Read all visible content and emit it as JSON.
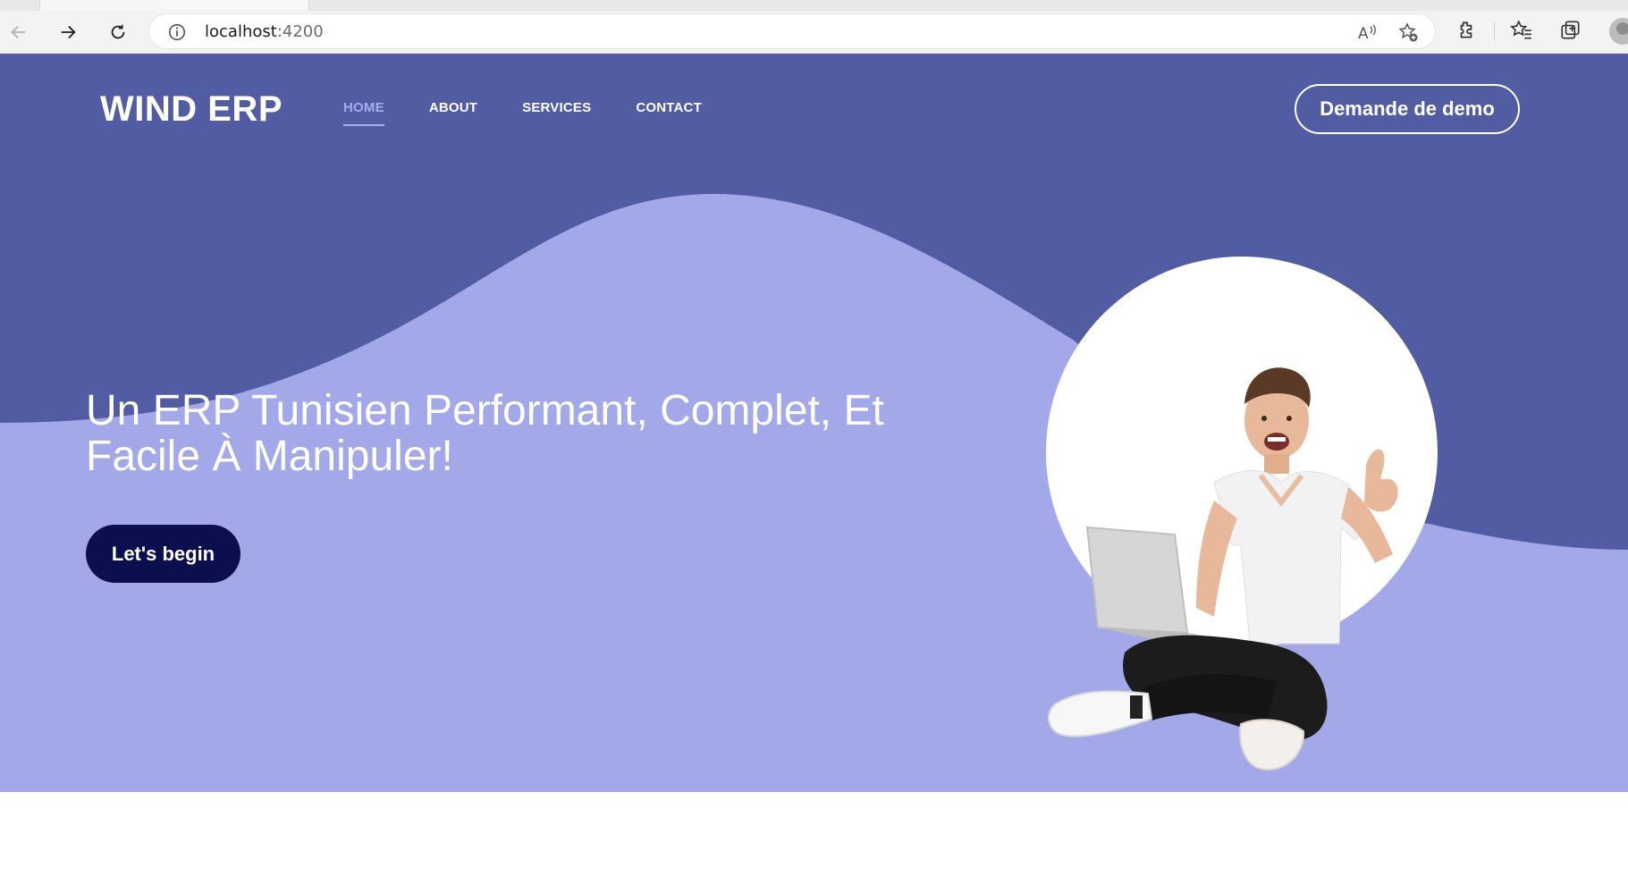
{
  "browser": {
    "url_host": "localhost",
    "url_port": ":4200",
    "icons": [
      "back-arrow-icon",
      "forward-arrow-icon",
      "refresh-icon",
      "info-icon",
      "read-aloud-icon",
      "favorite-add-icon",
      "extensions-icon",
      "favorites-icon",
      "collections-icon",
      "profile-icon"
    ]
  },
  "header": {
    "logo": "WIND ERP",
    "nav": [
      {
        "label": "HOME",
        "active": true
      },
      {
        "label": "ABOUT",
        "active": false
      },
      {
        "label": "SERVICES",
        "active": false
      },
      {
        "label": "CONTACT",
        "active": false
      }
    ],
    "demo_button": "Demande de demo"
  },
  "hero": {
    "headline_line1": "Un ERP Tunisien Performant, Complet, Et",
    "headline_line2": "Facile À Manipuler!",
    "cta_button": "Let's begin",
    "image": "man-with-laptop-thumbs-up"
  },
  "colors": {
    "hero_dark": "#525ca3",
    "hero_light": "#a2a8e8",
    "cta_bg": "#0c0f4d",
    "active_nav": "#a7acec"
  }
}
